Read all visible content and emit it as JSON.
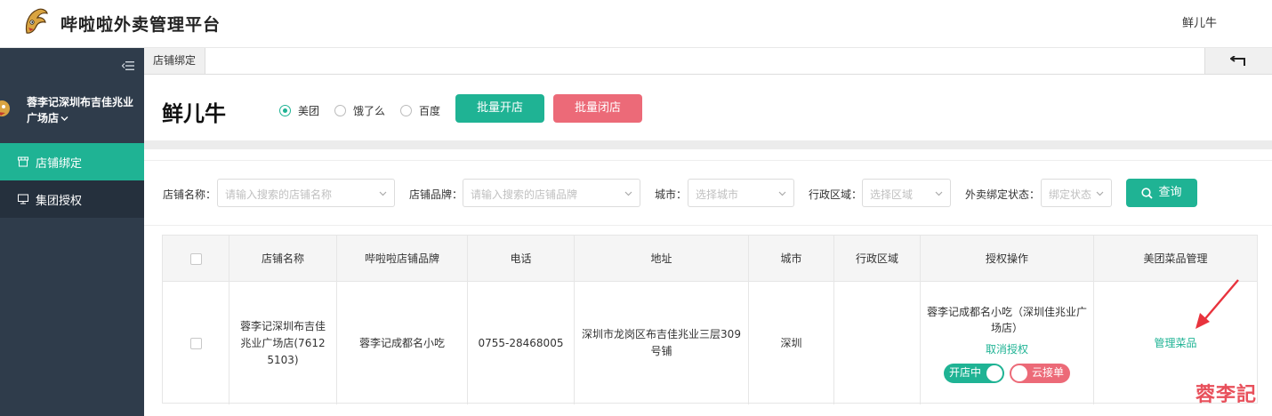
{
  "header": {
    "app_title": "哔啦啦外卖管理平台",
    "user_name": "鲜儿牛"
  },
  "sidebar": {
    "store_name": "蓉李记深圳布吉佳兆业广场店",
    "menu": [
      {
        "label": "店铺绑定",
        "icon": "store-icon",
        "active": true
      },
      {
        "label": "集团授权",
        "icon": "monitor-icon",
        "active": false
      }
    ]
  },
  "tabs": [
    {
      "label": "店铺绑定"
    }
  ],
  "page": {
    "brand_title": "鲜儿牛",
    "platforms": [
      {
        "label": "美团",
        "checked": true
      },
      {
        "label": "饿了么",
        "checked": false
      },
      {
        "label": "百度",
        "checked": false
      }
    ],
    "batch_open_label": "批量开店",
    "batch_close_label": "批量闭店"
  },
  "filters": {
    "store_name": {
      "label": "店铺名称：",
      "placeholder": "请输入搜索的店铺名称"
    },
    "store_brand": {
      "label": "店铺品牌：",
      "placeholder": "请输入搜索的店铺品牌"
    },
    "city": {
      "label": "城市：",
      "placeholder": "选择城市"
    },
    "district": {
      "label": "行政区域：",
      "placeholder": "选择区域"
    },
    "bind_status": {
      "label": "外卖绑定状态：",
      "placeholder": "绑定状态"
    },
    "query_label": "查询"
  },
  "table": {
    "columns": [
      "店铺名称",
      "哔啦啦店铺品牌",
      "电话",
      "地址",
      "城市",
      "行政区域",
      "授权操作",
      "美团菜品管理"
    ],
    "rows": [
      {
        "store_name": "蓉李记深圳布吉佳兆业广场店(76125103)",
        "brand": "蓉李记成都名小吃",
        "phone": "0755-28468005",
        "address": "深圳市龙岗区布吉佳兆业三层309号铺",
        "city": "深圳",
        "district": "",
        "auth_store": "蓉李记成都名小吃（深圳佳兆业广场店）",
        "cancel_auth": "取消授权",
        "open_toggle": "开店中",
        "cloud_toggle": "云接单",
        "manage_dishes": "管理菜品"
      }
    ]
  },
  "watermark": "蓉李記",
  "colors": {
    "accent": "#1fb394",
    "danger": "#ec6a78",
    "sidebar": "#2f3c4b"
  }
}
